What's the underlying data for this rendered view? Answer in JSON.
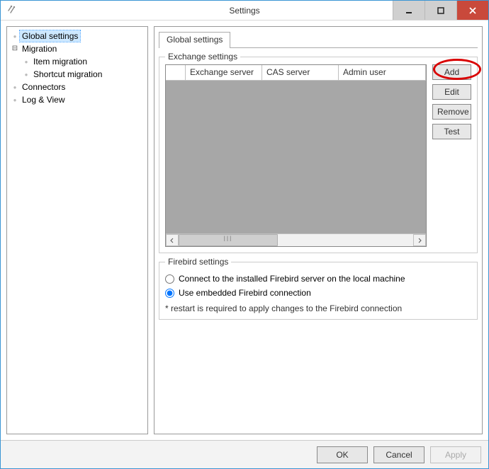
{
  "title": "Settings",
  "tree": {
    "global": "Global settings",
    "migration": "Migration",
    "item_migration": "Item migration",
    "shortcut_migration": "Shortcut migration",
    "connectors": "Connectors",
    "log_view": "Log & View"
  },
  "tabs": {
    "global": "Global settings"
  },
  "exchange": {
    "group_title": "Exchange settings",
    "columns": {
      "server": "Exchange server",
      "cas": "CAS server",
      "admin": "Admin user"
    },
    "buttons": {
      "add": "Add",
      "edit": "Edit",
      "remove": "Remove",
      "test": "Test"
    }
  },
  "firebird": {
    "group_title": "Firebird settings",
    "opt_installed": "Connect to the installed Firebird server on the local machine",
    "opt_embedded": "Use embedded Firebird connection",
    "note": "* restart is required to apply changes to the Firebird connection"
  },
  "footer": {
    "ok": "OK",
    "cancel": "Cancel",
    "apply": "Apply"
  },
  "scroll": {
    "grip": "lll"
  }
}
